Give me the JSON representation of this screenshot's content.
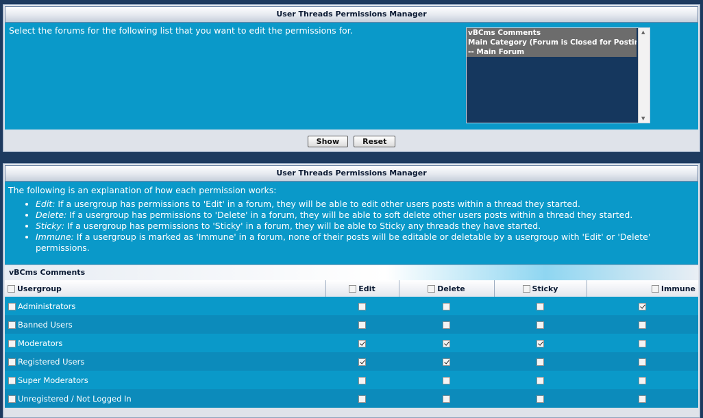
{
  "panel1": {
    "title": "User Threads Permissions Manager",
    "instructions": "Select the forums for the following list that you want to edit the permissions for.",
    "forum_options": [
      {
        "label": "vBCms Comments",
        "selected": true
      },
      {
        "label": "Main Category (Forum is Closed for Posting)",
        "selected": true
      },
      {
        "label": "-- Main Forum",
        "selected": true
      }
    ],
    "show_label": "Show",
    "reset_label": "Reset"
  },
  "panel2": {
    "title": "User Threads Permissions Manager",
    "explanation_intro": "The following is an explanation of how each permission works:",
    "explanations": [
      {
        "term": "Edit:",
        "text": " If a usergroup has permissions to 'Edit' in a forum, they will be able to edit other users posts within a thread they started."
      },
      {
        "term": "Delete:",
        "text": " If a usergroup has permissions to 'Delete' in a forum, they will be able to soft delete other users posts within a thread they started."
      },
      {
        "term": "Sticky:",
        "text": " If a usergroup has permissions to 'Sticky' in a forum, they will be able to Sticky any threads they have started."
      },
      {
        "term": "Immune:",
        "text": " If a usergroup is marked as 'Immune' in a forum, none of their posts will be editable or deletable by a usergroup with 'Edit' or 'Delete' permissions."
      }
    ],
    "forum_name": "vBCms Comments",
    "columns": {
      "usergroup": "Usergroup",
      "edit": "Edit",
      "delete": "Delete",
      "sticky": "Sticky",
      "immune": "Immune"
    },
    "rows": [
      {
        "name": "Administrators",
        "edit": false,
        "delete": false,
        "sticky": false,
        "immune": true
      },
      {
        "name": "Banned Users",
        "edit": false,
        "delete": false,
        "sticky": false,
        "immune": false
      },
      {
        "name": "Moderators",
        "edit": true,
        "delete": true,
        "sticky": true,
        "immune": false
      },
      {
        "name": "Registered Users",
        "edit": true,
        "delete": true,
        "sticky": false,
        "immune": false
      },
      {
        "name": "Super Moderators",
        "edit": false,
        "delete": false,
        "sticky": false,
        "immune": false
      },
      {
        "name": "Unregistered / Not Logged In",
        "edit": false,
        "delete": false,
        "sticky": false,
        "immune": false
      }
    ]
  }
}
